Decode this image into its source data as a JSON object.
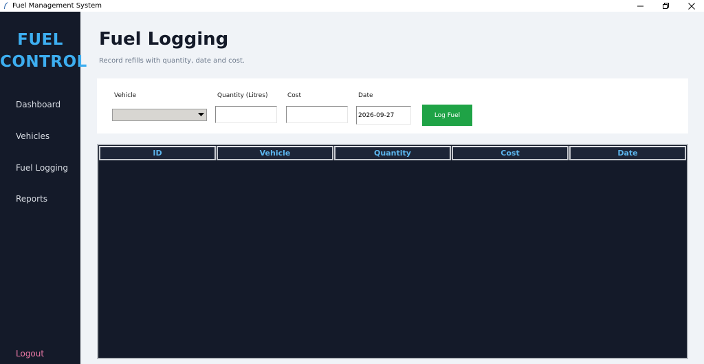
{
  "window": {
    "title": "Fuel Management System",
    "controls": [
      "minimize-icon",
      "restore-icon",
      "close-icon"
    ]
  },
  "sidebar": {
    "logo_line1": "FUEL",
    "logo_line2": "CONTROL",
    "items": [
      {
        "label": "Dashboard"
      },
      {
        "label": "Vehicles"
      },
      {
        "label": "Fuel Logging"
      },
      {
        "label": "Reports"
      }
    ],
    "logout": "Logout"
  },
  "main": {
    "title": "Fuel Logging",
    "subtitle": "Record refills with quantity, date and cost."
  },
  "form": {
    "vehicle_label": "Vehicle",
    "vehicle_value": "",
    "quantity_label": "Quantity (Litres)",
    "quantity_value": "",
    "cost_label": "Cost",
    "cost_value": "",
    "date_label": "Date",
    "date_value": "2026-09-27",
    "submit_label": "Log Fuel"
  },
  "table": {
    "columns": [
      "ID",
      "Vehicle",
      "Quantity",
      "Cost",
      "Date"
    ],
    "rows": []
  },
  "colors": {
    "sidebar_bg": "#141a29",
    "accent_blue": "#3daef0",
    "success_green": "#1fa346",
    "logout_pink": "#ef7aa8"
  }
}
